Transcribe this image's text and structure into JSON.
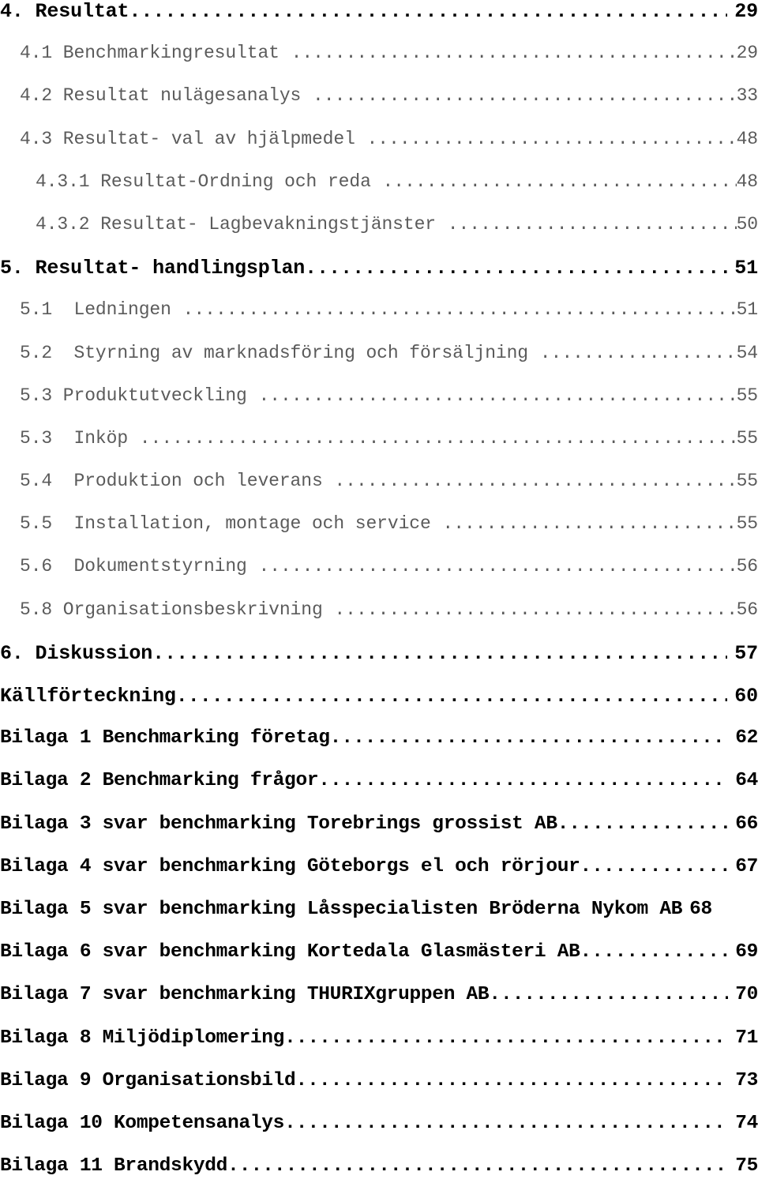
{
  "document": {
    "kind": "table-of-contents",
    "language": "sv"
  },
  "leader": {
    "dot_char": ".",
    "repeat": "................................................................................................"
  },
  "entries": [
    {
      "id": "ch-4",
      "level": 1,
      "title": "4. Resultat",
      "page": "29",
      "leader": true
    },
    {
      "id": "sec-4-1",
      "level": 2,
      "title": "4.1 Benchmarkingresultat ",
      "page": "29",
      "leader": true
    },
    {
      "id": "sec-4-2",
      "level": 2,
      "title": "4.2 Resultat nulägesanalys ",
      "page": "33",
      "leader": true
    },
    {
      "id": "sec-4-3",
      "level": 2,
      "title": "4.3 Resultat- val av hjälpmedel ",
      "page": "48",
      "leader": true
    },
    {
      "id": "sec-4-3-1",
      "level": 3,
      "title": "4.3.1 Resultat-Ordning och reda ",
      "page": "48",
      "leader": true
    },
    {
      "id": "sec-4-3-2",
      "level": 3,
      "title": "4.3.2 Resultat- Lagbevakningstjänster ",
      "page": "50",
      "leader": true
    },
    {
      "id": "ch-5",
      "level": 1,
      "title": "5. Resultat- handlingsplan",
      "page": "51",
      "leader": true
    },
    {
      "id": "sec-5-1",
      "level": 2,
      "title": "5.1  Ledningen ",
      "page": "51",
      "leader": true
    },
    {
      "id": "sec-5-2",
      "level": 2,
      "title": "5.2  Styrning av marknadsföring och försäljning ",
      "page": "54",
      "leader": true
    },
    {
      "id": "sec-5-3-produktutveckling",
      "level": 2,
      "title": "5.3 Produktutveckling ",
      "page": "55",
      "leader": true
    },
    {
      "id": "sec-5-3-inkop",
      "level": 2,
      "title": "5.3  Inköp ",
      "page": "55",
      "leader": true
    },
    {
      "id": "sec-5-4",
      "level": 2,
      "title": "5.4  Produktion och leverans ",
      "page": "55",
      "leader": true
    },
    {
      "id": "sec-5-5",
      "level": 2,
      "title": "5.5  Installation, montage och service ",
      "page": "55",
      "leader": true
    },
    {
      "id": "sec-5-6",
      "level": 2,
      "title": "5.6  Dokumentstyrning ",
      "page": "56",
      "leader": true
    },
    {
      "id": "sec-5-8",
      "level": 2,
      "title": "5.8 Organisationsbeskrivning ",
      "page": "56",
      "leader": true
    },
    {
      "id": "ch-6",
      "level": 1,
      "title": "6. Diskussion",
      "page": "57",
      "leader": true
    },
    {
      "id": "kallforteckning",
      "level": 1,
      "title": "Källförteckning",
      "page": "60",
      "leader": true
    },
    {
      "id": "bilaga-1",
      "level": 1,
      "variant": "bilaga",
      "title": "Bilaga 1 Benchmarking företag",
      "page": "62",
      "leader": true
    },
    {
      "id": "bilaga-2",
      "level": 1,
      "variant": "bilaga",
      "title": "Bilaga 2 Benchmarking frågor",
      "page": "64",
      "leader": true
    },
    {
      "id": "bilaga-3",
      "level": 1,
      "variant": "bilaga",
      "title": "Bilaga 3 svar benchmarking Torebrings grossist AB",
      "page": "66",
      "leader": true
    },
    {
      "id": "bilaga-4",
      "level": 1,
      "variant": "bilaga",
      "title": "Bilaga 4 svar benchmarking Göteborgs el och rörjour",
      "page": "67",
      "leader": true
    },
    {
      "id": "bilaga-5",
      "level": 1,
      "variant": "bilaga",
      "title": "Bilaga 5 svar benchmarking Låsspecialisten Bröderna Nykom AB",
      "page": "68",
      "leader": false
    },
    {
      "id": "bilaga-6",
      "level": 1,
      "variant": "bilaga",
      "title": "Bilaga 6 svar benchmarking Kortedala Glasmästeri AB",
      "page": "69",
      "leader": true
    },
    {
      "id": "bilaga-7",
      "level": 1,
      "variant": "bilaga",
      "title": "Bilaga 7 svar benchmarking THURIXgruppen AB",
      "page": "70",
      "leader": true
    },
    {
      "id": "bilaga-8",
      "level": 1,
      "variant": "bilaga",
      "title": "Bilaga 8 Miljödiplomering",
      "page": "71",
      "leader": true
    },
    {
      "id": "bilaga-9",
      "level": 1,
      "variant": "bilaga",
      "title": "Bilaga 9 Organisationsbild",
      "page": "73",
      "leader": true
    },
    {
      "id": "bilaga-10",
      "level": 1,
      "variant": "bilaga",
      "title": "Bilaga 10 Kompetensanalys",
      "page": "74",
      "leader": true
    },
    {
      "id": "bilaga-11",
      "level": 1,
      "variant": "bilaga",
      "title": "Bilaga 11 Brandskydd",
      "page": "75",
      "leader": true
    }
  ]
}
